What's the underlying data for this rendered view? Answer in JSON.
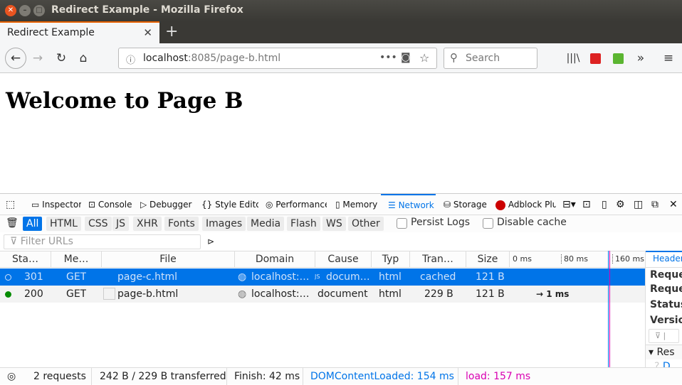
{
  "window": {
    "title": "Redirect Example - Mozilla Firefox"
  },
  "tab": {
    "title": "Redirect Example"
  },
  "nav": {
    "url_host": "localhost",
    "url_rest": ":8085/page-b.html",
    "search_placeholder": "Search",
    "page_actions": "•••"
  },
  "page": {
    "heading": "Welcome to Page B"
  },
  "devtools": {
    "tabs": [
      "Inspector",
      "Console",
      "Debugger",
      "Style Editor",
      "Performance",
      "Memory",
      "Network",
      "Storage",
      "Adblock Plus"
    ],
    "selected_tab": "Network",
    "filters": [
      "All",
      "HTML",
      "CSS",
      "JS",
      "XHR",
      "Fonts",
      "Images",
      "Media",
      "Flash",
      "WS",
      "Other"
    ],
    "selected_filter": "All",
    "persist_logs": "Persist Logs",
    "disable_cache": "Disable cache",
    "filter_placeholder": "Filter URLs",
    "columns": [
      "Sta…",
      "Me…",
      "File",
      "Domain",
      "Cause",
      "Typ",
      "Tran…",
      "Size"
    ],
    "timeline_ticks": [
      "0 ms",
      "80 ms",
      "160 ms"
    ],
    "requests": [
      {
        "status": "301",
        "method": "GET",
        "file": "page-c.html",
        "domain": "localhost:…",
        "cause": "docum…",
        "type": "html",
        "transferred": "cached",
        "size": "121 B",
        "timing": "",
        "selected": true,
        "status_color": "#ffffff"
      },
      {
        "status": "200",
        "method": "GET",
        "file": "page-b.html",
        "domain": "localhost:…",
        "cause": "document",
        "type": "html",
        "transferred": "229 B",
        "size": "121 B",
        "timing": "→ 1 ms",
        "selected": false,
        "status_color": "#058b00"
      }
    ],
    "side": {
      "tab": "Headers",
      "lines": [
        "Reque",
        "Reque",
        "Status",
        "Versio"
      ],
      "section": "Res",
      "item": "D"
    },
    "status": {
      "requests": "2 requests",
      "transferred": "242 B / 229 B transferred",
      "finish": "Finish: 42 ms",
      "dcl": "DOMContentLoaded: 154 ms",
      "load": "load: 157 ms"
    },
    "colors": {
      "accent": "#0074e8",
      "dcl": "#0074e8",
      "load": "#d900b2"
    }
  }
}
